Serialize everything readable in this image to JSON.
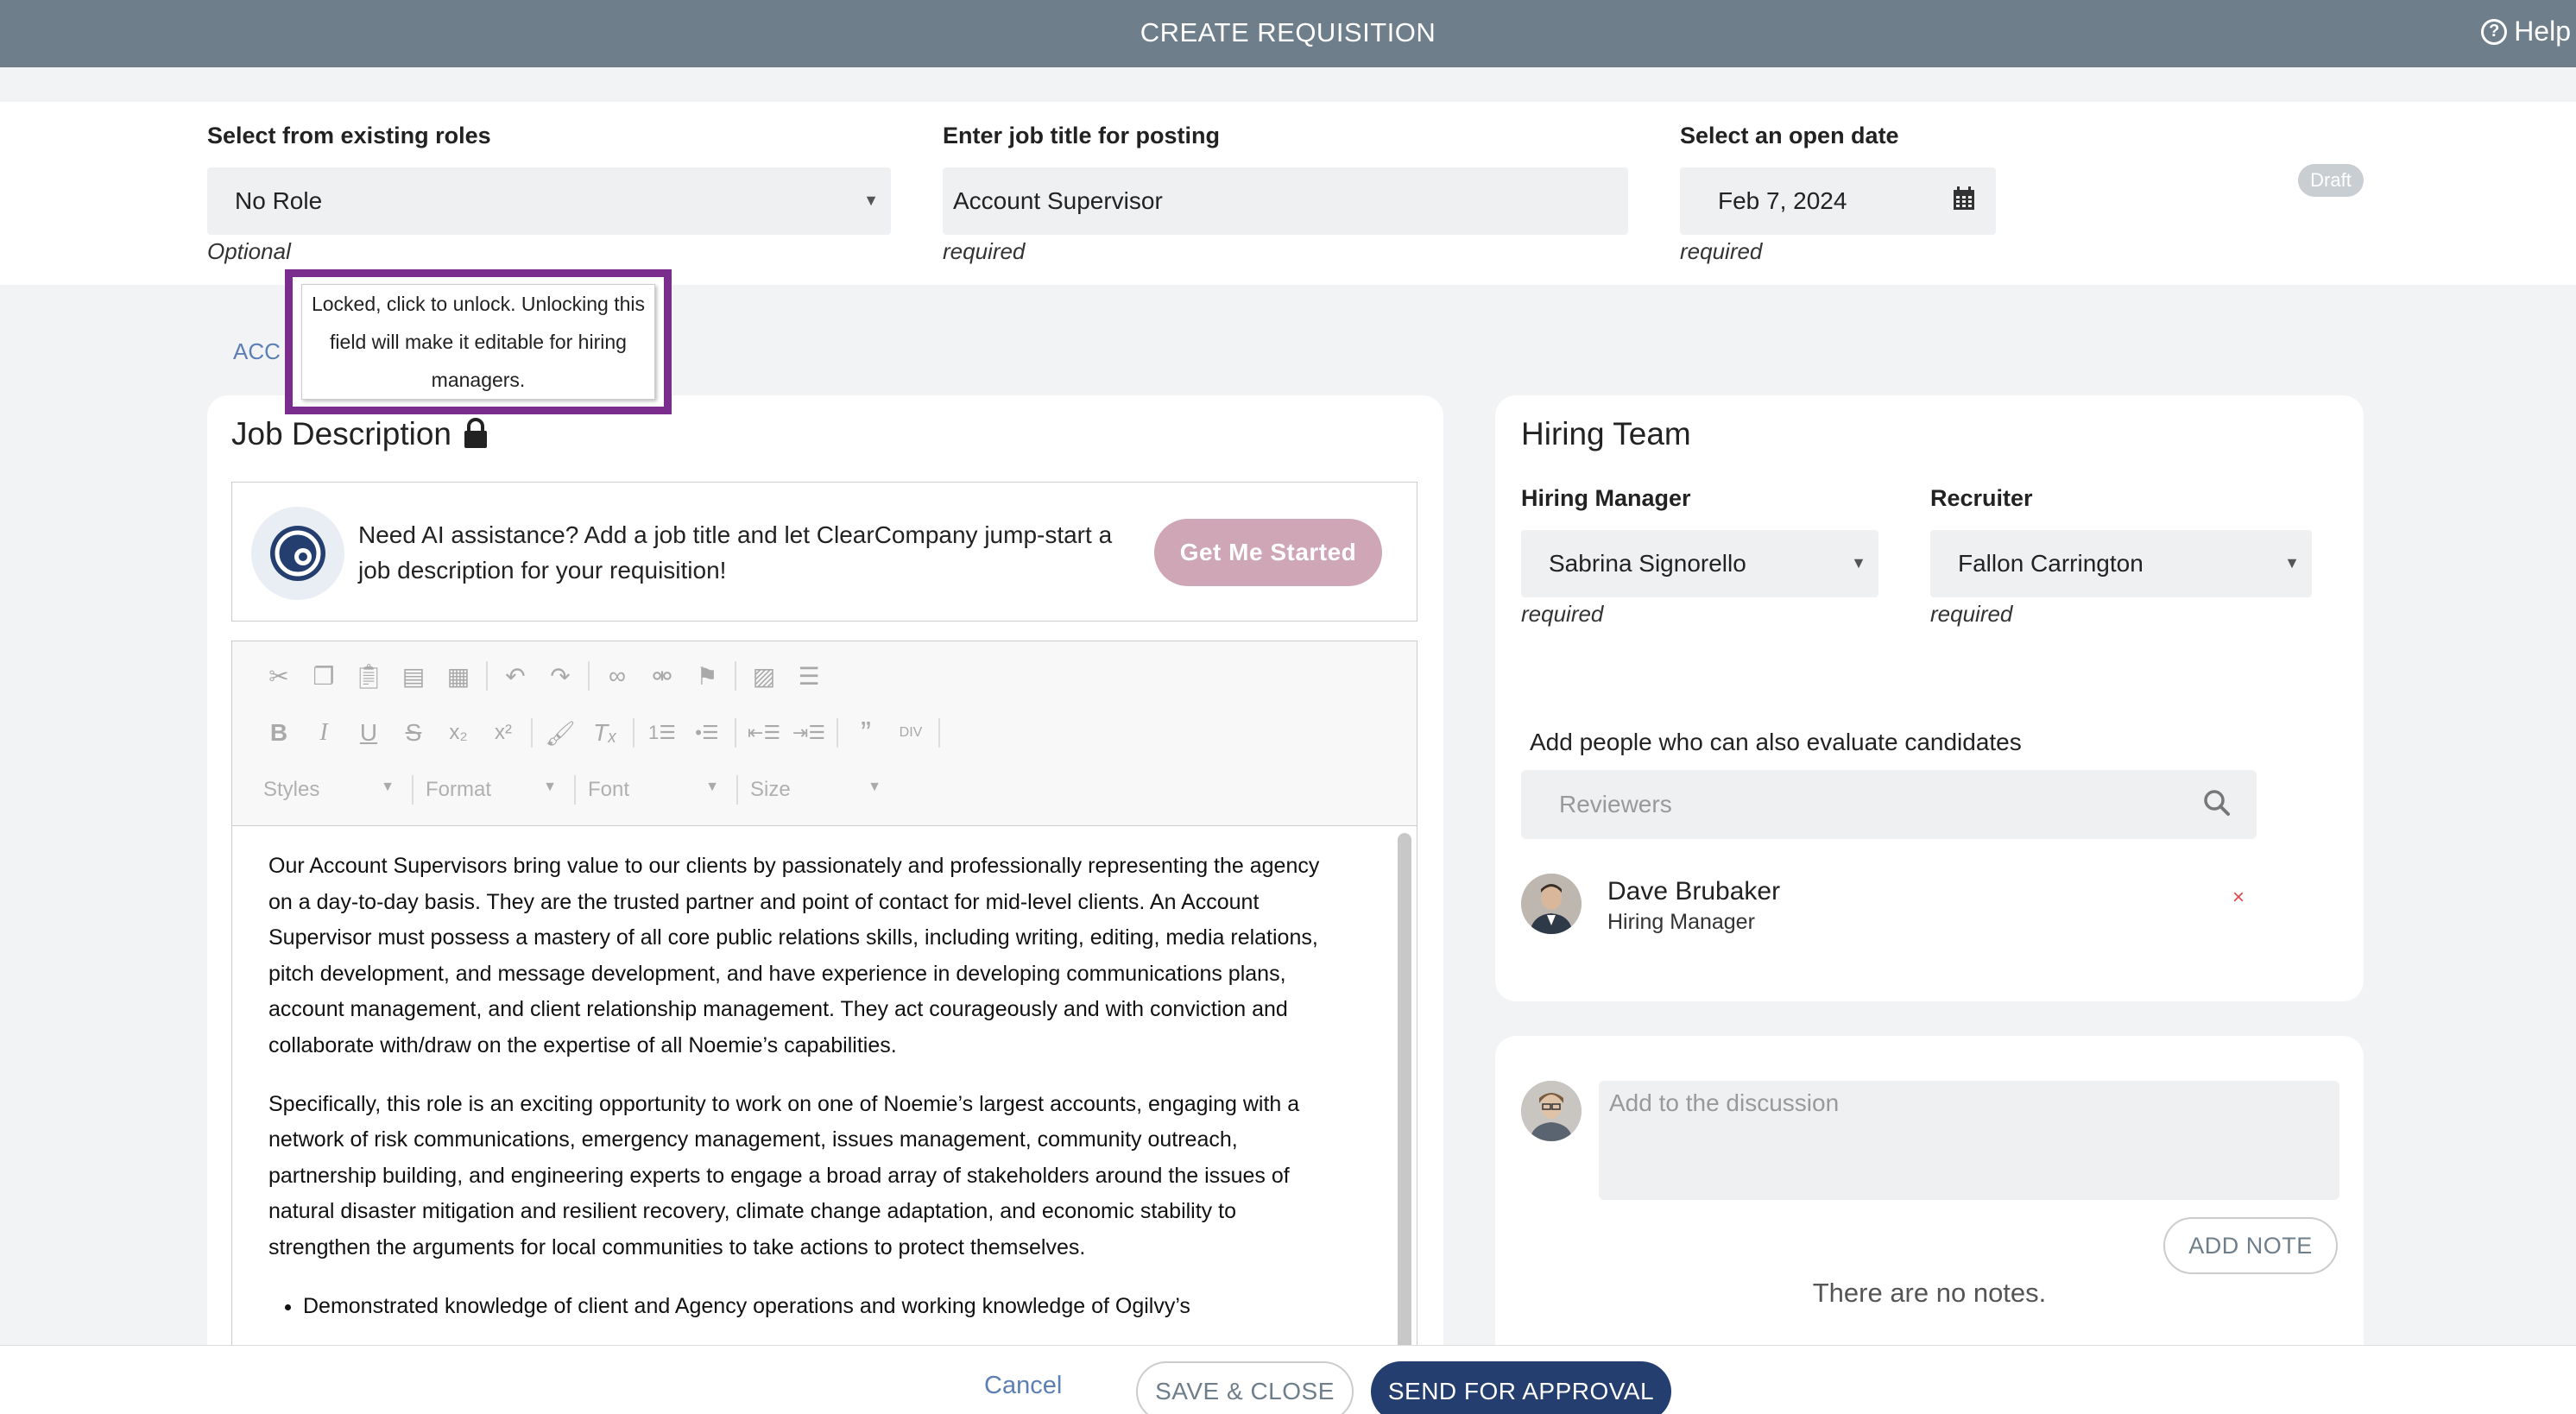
{
  "app": {
    "title": "CREATE REQUISITION",
    "help_label": "Help"
  },
  "header": {
    "existing_roles": {
      "label": "Select from existing roles",
      "value": "No Role",
      "hint": "Optional"
    },
    "job_title": {
      "label": "Enter job title for posting",
      "value": "Account Supervisor",
      "hint": "required"
    },
    "open_date": {
      "label": "Select an open date",
      "value": "Feb 7, 2024",
      "hint": "required"
    },
    "status_badge": "Draft"
  },
  "tab_stub": "ACC",
  "tooltip": {
    "text": "Locked, click to unlock. Unlocking this field will make it editable for hiring managers."
  },
  "job_description": {
    "title": "Job Description",
    "ai": {
      "text": "Need AI assistance? Add a job title and let ClearCompany jump-start a job description for your requisition!",
      "button": "Get Me Started"
    },
    "toolbar": {
      "combos": [
        "Styles",
        "Format",
        "Font",
        "Size"
      ]
    },
    "paragraphs": [
      "Our Account Supervisors bring value to our clients by passionately and professionally representing the agency on a day-to-day basis. They are the trusted partner and point of contact for mid-level clients. An Account Supervisor must possess a mastery of all core public relations skills, including writing, editing, media relations, pitch development, and message development, and have experience in developing communications plans, account management, and client relationship management. They act courageously and with conviction and collaborate with/draw on the expertise of all Noemie’s capabilities.",
      "Specifically, this role is an exciting opportunity to work on one of Noemie’s largest accounts, engaging with a network of risk communications, emergency management, issues management, community outreach, partnership building, and engineering experts to engage a broad array of stakeholders around the issues of natural disaster mitigation and resilient recovery, climate change adaptation, and economic stability to strengthen the arguments for local communities to take actions to protect themselves."
    ],
    "bullets": [
      "Demonstrated knowledge of client and Agency operations and working knowledge of Ogilvy’s"
    ]
  },
  "hiring_team": {
    "title": "Hiring Team",
    "hiring_manager": {
      "label": "Hiring Manager",
      "value": "Sabrina Signorello",
      "hint": "required"
    },
    "recruiter": {
      "label": "Recruiter",
      "value": "Fallon Carrington",
      "hint": "required"
    },
    "reviewers_label": "Add people who can also evaluate candidates",
    "reviewers_placeholder": "Reviewers",
    "members": [
      {
        "name": "Dave Brubaker",
        "role": "Hiring Manager",
        "remove": "×"
      }
    ]
  },
  "discussion": {
    "placeholder": "Add to the discussion",
    "add_note": "ADD NOTE",
    "empty": "There are no notes."
  },
  "footer": {
    "cancel": "Cancel",
    "save_close": "SAVE & CLOSE",
    "send": "SEND FOR APPROVAL"
  },
  "colors": {
    "topbar": "#6e7e8b",
    "primary": "#243f6f",
    "ai_button": "#cfa6b6",
    "tooltip_border": "#7b2d8e",
    "link": "#5b7fb5"
  }
}
